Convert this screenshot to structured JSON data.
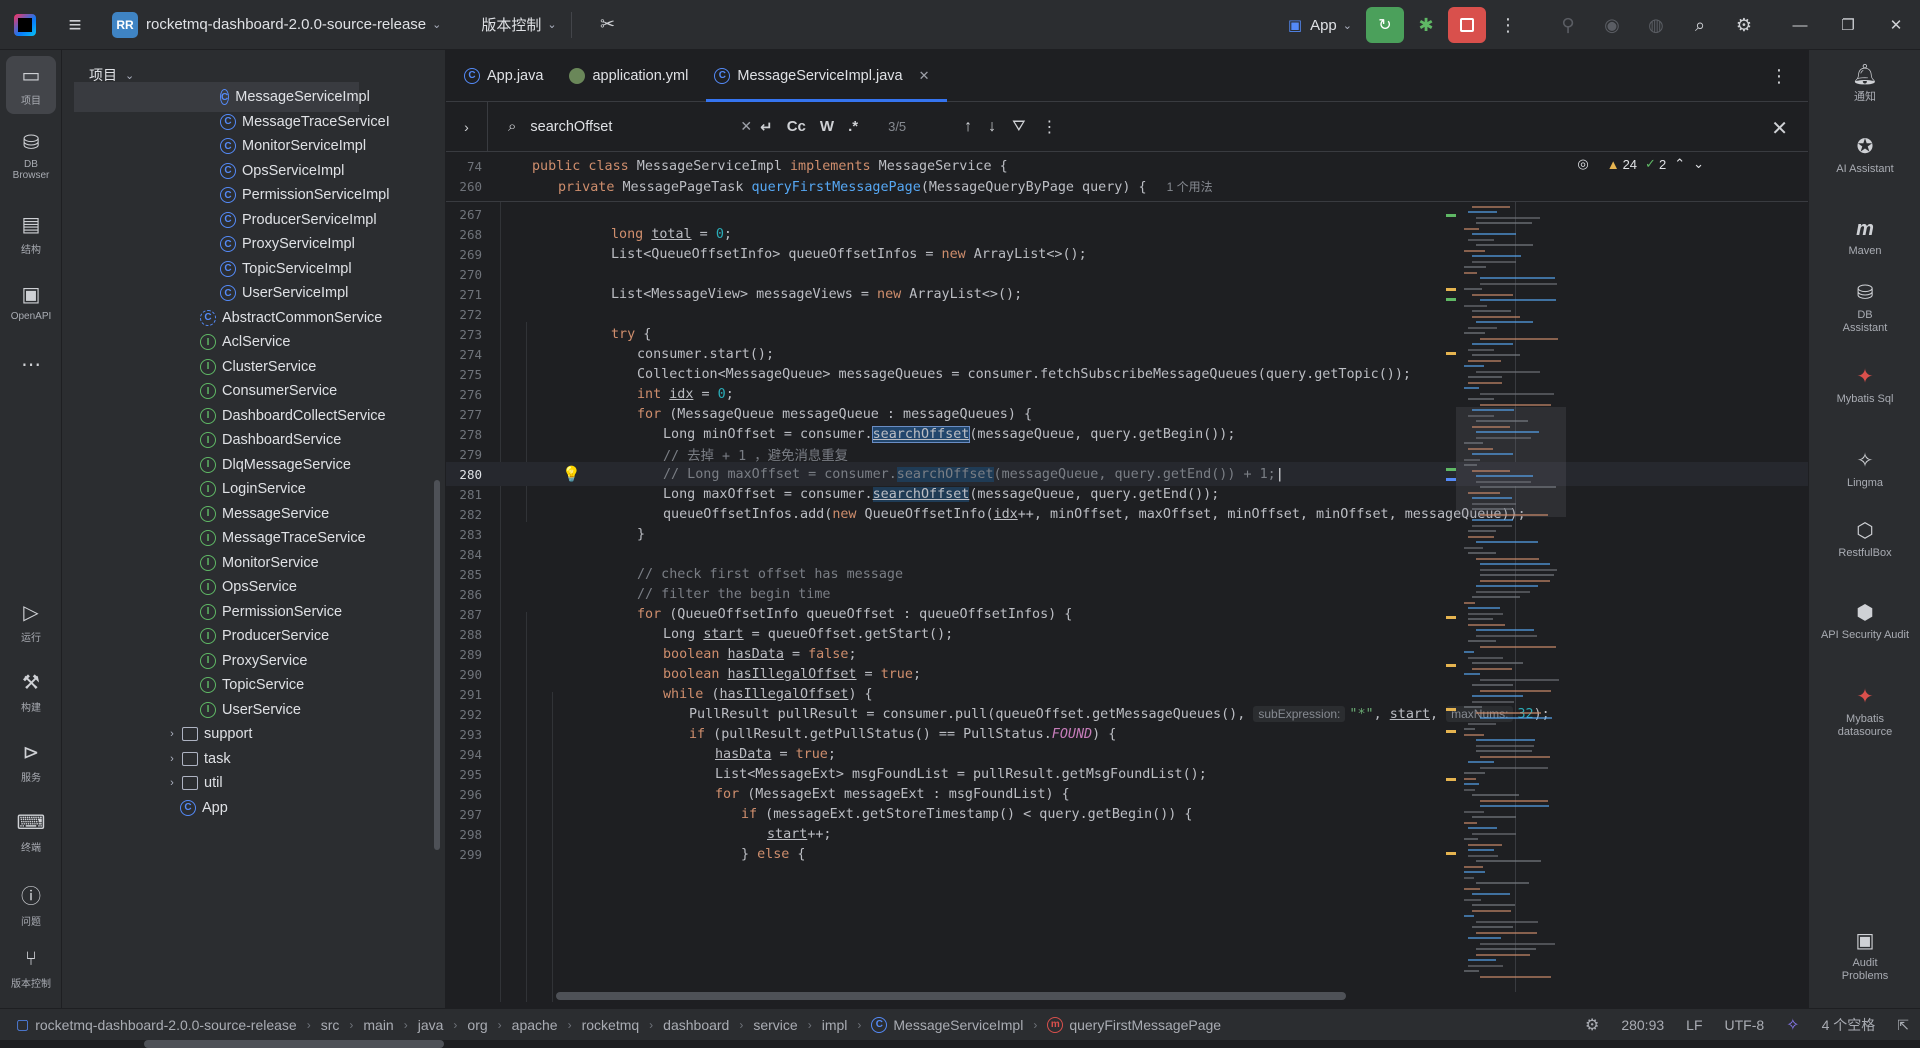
{
  "titlebar": {
    "project_badge": "RR",
    "project_name": "rocketmq-dashboard-2.0.0-source-release",
    "vcs": "版本控制",
    "run_config": "App"
  },
  "left_strip": [
    {
      "icon": "folder-icon",
      "label": "项目"
    },
    {
      "icon": "db-browser-icon",
      "label": "DB Browser"
    },
    {
      "icon": "structure-icon",
      "label": "结构"
    },
    {
      "icon": "openapi-icon",
      "label": "OpenAPI"
    },
    {
      "icon": "more-icon",
      "label": ""
    },
    {
      "icon": "run-icon",
      "label": "运行"
    },
    {
      "icon": "build-icon",
      "label": "构建"
    },
    {
      "icon": "services-icon",
      "label": "服务"
    },
    {
      "icon": "terminal-icon",
      "label": "终端"
    },
    {
      "icon": "problems-icon",
      "label": "问题"
    },
    {
      "icon": "git-icon",
      "label": "版本控制"
    }
  ],
  "project_panel": {
    "title": "项目",
    "tree": [
      {
        "kind": "class",
        "label": "MessageServiceImpl",
        "selected": true
      },
      {
        "kind": "class",
        "label": "MessageTraceServiceI"
      },
      {
        "kind": "class",
        "label": "MonitorServiceImpl"
      },
      {
        "kind": "class",
        "label": "OpsServiceImpl"
      },
      {
        "kind": "class",
        "label": "PermissionServiceImpl"
      },
      {
        "kind": "class",
        "label": "ProducerServiceImpl"
      },
      {
        "kind": "class",
        "label": "ProxyServiceImpl"
      },
      {
        "kind": "class",
        "label": "TopicServiceImpl"
      },
      {
        "kind": "class",
        "label": "UserServiceImpl"
      },
      {
        "kind": "abstract",
        "label": "AbstractCommonService"
      },
      {
        "kind": "interface",
        "label": "AclService"
      },
      {
        "kind": "interface",
        "label": "ClusterService"
      },
      {
        "kind": "interface",
        "label": "ConsumerService"
      },
      {
        "kind": "interface",
        "label": "DashboardCollectService"
      },
      {
        "kind": "interface",
        "label": "DashboardService"
      },
      {
        "kind": "interface",
        "label": "DlqMessageService"
      },
      {
        "kind": "interface",
        "label": "LoginService"
      },
      {
        "kind": "interface",
        "label": "MessageService"
      },
      {
        "kind": "interface",
        "label": "MessageTraceService"
      },
      {
        "kind": "interface",
        "label": "MonitorService"
      },
      {
        "kind": "interface",
        "label": "OpsService"
      },
      {
        "kind": "interface",
        "label": "PermissionService"
      },
      {
        "kind": "interface",
        "label": "ProducerService"
      },
      {
        "kind": "interface",
        "label": "ProxyService"
      },
      {
        "kind": "interface",
        "label": "TopicService"
      },
      {
        "kind": "interface",
        "label": "UserService"
      },
      {
        "kind": "package",
        "label": "support"
      },
      {
        "kind": "package",
        "label": "task"
      },
      {
        "kind": "package",
        "label": "util"
      },
      {
        "kind": "class",
        "label": "App"
      }
    ]
  },
  "tabs": [
    {
      "label": "App.java",
      "icon": "java-class-icon"
    },
    {
      "label": "application.yml",
      "icon": "yaml-icon"
    },
    {
      "label": "MessageServiceImpl.java",
      "icon": "java-class-icon",
      "active": true
    }
  ],
  "find": {
    "query": "searchOffset",
    "count": "3/5",
    "case_label": "Cc",
    "word_label": "W",
    "regex_label": ".*"
  },
  "inspections": {
    "warnings": "24",
    "weak": "2"
  },
  "sticky_lines": [
    {
      "n": "74"
    },
    {
      "n": "260",
      "usages": "1 个用法"
    }
  ],
  "code_lines": [
    "267",
    "268",
    "269",
    "270",
    "271",
    "272",
    "273",
    "274",
    "275",
    "276",
    "277",
    "278",
    "279",
    "280",
    "281",
    "282",
    "283",
    "284",
    "285",
    "286",
    "287",
    "288",
    "289",
    "290",
    "291",
    "292",
    "293",
    "294",
    "295",
    "296",
    "297",
    "298",
    "299"
  ],
  "hints": {
    "sub": "subExpression:",
    "max": "maxNums:"
  },
  "colors": {
    "keyword": "#cf8e6d",
    "function": "#56a8f5",
    "number": "#2aacb8",
    "string": "#6aab73",
    "comment": "#7a7e85",
    "accent": "#3574f0"
  },
  "right_strip": [
    {
      "icon": "bell-icon",
      "label": "通知"
    },
    {
      "icon": "ai-assistant-icon",
      "label": "AI Assistant"
    },
    {
      "icon": "maven-icon",
      "label": "Maven"
    },
    {
      "icon": "db-assistant-icon",
      "label": "DB Assistant"
    },
    {
      "icon": "mybatis-icon",
      "label": "Mybatis Sql"
    },
    {
      "icon": "lingma-icon",
      "label": "Lingma"
    },
    {
      "icon": "restfulbox-icon",
      "label": "RestfulBox"
    },
    {
      "icon": "api-security-icon",
      "label": "API Security Audit"
    },
    {
      "icon": "mybatis-icon",
      "label": "Mybatis datasource"
    },
    {
      "icon": "audit-icon",
      "label": "Audit Problems"
    }
  ],
  "status": {
    "breadcrumbs": [
      "rocketmq-dashboard-2.0.0-source-release",
      "src",
      "main",
      "java",
      "org",
      "apache",
      "rocketmq",
      "dashboard",
      "service",
      "impl",
      "MessageServiceImpl",
      "queryFirstMessagePage"
    ],
    "position": "280:93",
    "line_sep": "LF",
    "encoding": "UTF-8",
    "indent": "4 个空格"
  }
}
